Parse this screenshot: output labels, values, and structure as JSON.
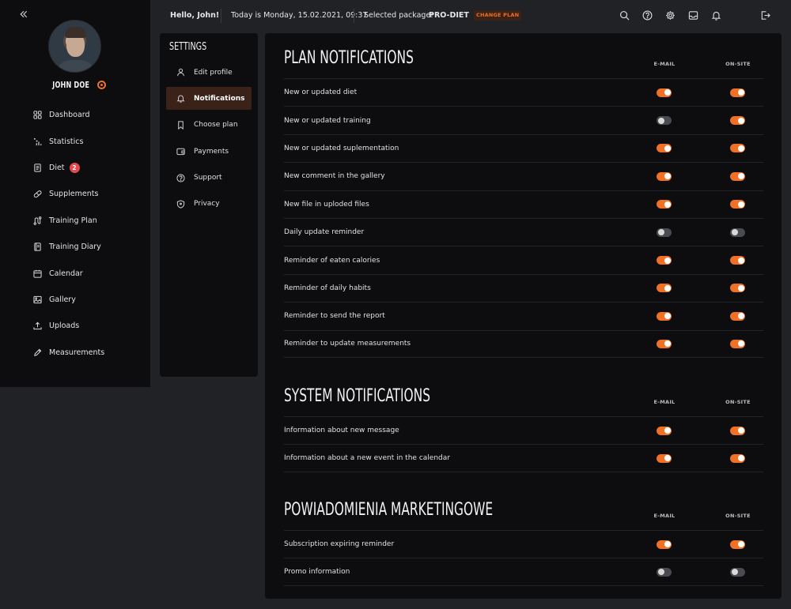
{
  "sidebar": {
    "user_name": "JOHN DOE",
    "nav": [
      {
        "label": "Dashboard",
        "icon": "grid-icon"
      },
      {
        "label": "Statistics",
        "icon": "chart-icon"
      },
      {
        "label": "Diet",
        "icon": "document-icon",
        "badge": "2"
      },
      {
        "label": "Supplements",
        "icon": "pill-icon"
      },
      {
        "label": "Training Plan",
        "icon": "route-icon"
      },
      {
        "label": "Training Diary",
        "icon": "book-icon"
      },
      {
        "label": "Calendar",
        "icon": "calendar-icon"
      },
      {
        "label": "Gallery",
        "icon": "image-icon"
      },
      {
        "label": "Uploads",
        "icon": "upload-icon"
      },
      {
        "label": "Measurements",
        "icon": "pencil-icon"
      }
    ]
  },
  "topbar": {
    "greeting": "Hello, John!",
    "date_text": "Today is Monday, 15.02.2021, 09:37",
    "package_label": "Selected package:",
    "package_value": "PRO-DIET",
    "change_plan": "CHANGE PLAN"
  },
  "settings": {
    "title": "SETTINGS",
    "items": [
      {
        "label": "Edit profile",
        "icon": "user-icon"
      },
      {
        "label": "Notifications",
        "icon": "bell-icon",
        "active": true
      },
      {
        "label": "Choose plan",
        "icon": "bookmark-icon"
      },
      {
        "label": "Payments",
        "icon": "wallet-icon"
      },
      {
        "label": "Support",
        "icon": "help-icon"
      },
      {
        "label": "Privacy",
        "icon": "shield-icon"
      }
    ]
  },
  "columns": {
    "email": "E-MAIL",
    "onsite": "ON-SITE"
  },
  "sections": [
    {
      "title": "PLAN NOTIFICATIONS",
      "rows": [
        {
          "label": "New or updated diet",
          "email": true,
          "onsite": true
        },
        {
          "label": "New or updated training",
          "email": false,
          "onsite": true
        },
        {
          "label": "New or updated suplementation",
          "email": true,
          "onsite": true
        },
        {
          "label": "New comment in the gallery",
          "email": true,
          "onsite": true
        },
        {
          "label": "New file in uploded files",
          "email": true,
          "onsite": true
        },
        {
          "label": "Daily update reminder",
          "email": false,
          "onsite": false
        },
        {
          "label": "Reminder of eaten calories",
          "email": true,
          "onsite": true
        },
        {
          "label": "Reminder of daily habits",
          "email": true,
          "onsite": true
        },
        {
          "label": "Reminder to send the report",
          "email": true,
          "onsite": true
        },
        {
          "label": "Reminder to update measurements",
          "email": true,
          "onsite": true
        }
      ]
    },
    {
      "title": "SYSTEM NOTIFICATIONS",
      "rows": [
        {
          "label": "Information about new message",
          "email": true,
          "onsite": true
        },
        {
          "label": "Information about a new event in the calendar",
          "email": true,
          "onsite": true
        }
      ]
    },
    {
      "title": "POWIADOMIENIA MARKETINGOWE",
      "rows": [
        {
          "label": "Subscription expiring reminder",
          "email": true,
          "onsite": true
        },
        {
          "label": "Promo information",
          "email": false,
          "onsite": false
        }
      ]
    }
  ],
  "colors": {
    "accent": "#f07025",
    "background": "#212226",
    "panel": "#0d0d0f",
    "badge": "#e5484d"
  }
}
